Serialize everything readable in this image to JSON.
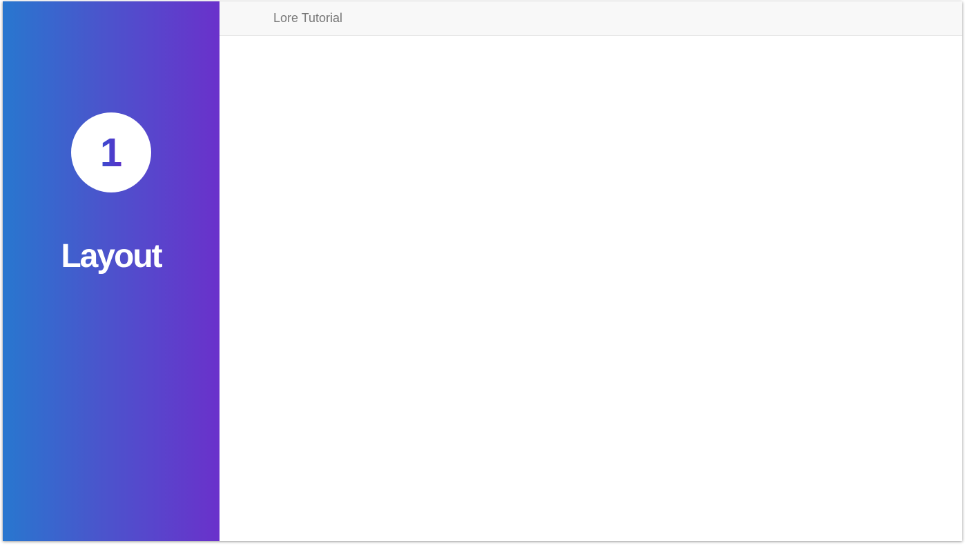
{
  "sidebar": {
    "step_number": "1",
    "step_title": "Layout",
    "gradient_colors": [
      "#2877cf",
      "#6a31cb"
    ]
  },
  "topbar": {
    "brand": "Lore Tutorial"
  }
}
